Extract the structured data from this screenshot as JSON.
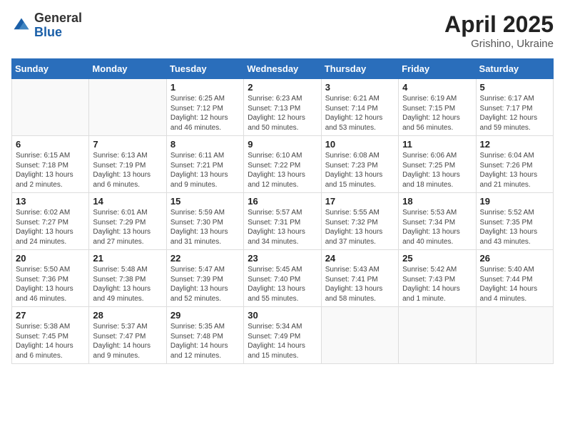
{
  "header": {
    "logo_general": "General",
    "logo_blue": "Blue",
    "month_year": "April 2025",
    "location": "Grishino, Ukraine"
  },
  "weekdays": [
    "Sunday",
    "Monday",
    "Tuesday",
    "Wednesday",
    "Thursday",
    "Friday",
    "Saturday"
  ],
  "weeks": [
    [
      {
        "day": null,
        "info": null
      },
      {
        "day": null,
        "info": null
      },
      {
        "day": "1",
        "info": "Sunrise: 6:25 AM\nSunset: 7:12 PM\nDaylight: 12 hours\nand 46 minutes."
      },
      {
        "day": "2",
        "info": "Sunrise: 6:23 AM\nSunset: 7:13 PM\nDaylight: 12 hours\nand 50 minutes."
      },
      {
        "day": "3",
        "info": "Sunrise: 6:21 AM\nSunset: 7:14 PM\nDaylight: 12 hours\nand 53 minutes."
      },
      {
        "day": "4",
        "info": "Sunrise: 6:19 AM\nSunset: 7:15 PM\nDaylight: 12 hours\nand 56 minutes."
      },
      {
        "day": "5",
        "info": "Sunrise: 6:17 AM\nSunset: 7:17 PM\nDaylight: 12 hours\nand 59 minutes."
      }
    ],
    [
      {
        "day": "6",
        "info": "Sunrise: 6:15 AM\nSunset: 7:18 PM\nDaylight: 13 hours\nand 2 minutes."
      },
      {
        "day": "7",
        "info": "Sunrise: 6:13 AM\nSunset: 7:19 PM\nDaylight: 13 hours\nand 6 minutes."
      },
      {
        "day": "8",
        "info": "Sunrise: 6:11 AM\nSunset: 7:21 PM\nDaylight: 13 hours\nand 9 minutes."
      },
      {
        "day": "9",
        "info": "Sunrise: 6:10 AM\nSunset: 7:22 PM\nDaylight: 13 hours\nand 12 minutes."
      },
      {
        "day": "10",
        "info": "Sunrise: 6:08 AM\nSunset: 7:23 PM\nDaylight: 13 hours\nand 15 minutes."
      },
      {
        "day": "11",
        "info": "Sunrise: 6:06 AM\nSunset: 7:25 PM\nDaylight: 13 hours\nand 18 minutes."
      },
      {
        "day": "12",
        "info": "Sunrise: 6:04 AM\nSunset: 7:26 PM\nDaylight: 13 hours\nand 21 minutes."
      }
    ],
    [
      {
        "day": "13",
        "info": "Sunrise: 6:02 AM\nSunset: 7:27 PM\nDaylight: 13 hours\nand 24 minutes."
      },
      {
        "day": "14",
        "info": "Sunrise: 6:01 AM\nSunset: 7:29 PM\nDaylight: 13 hours\nand 27 minutes."
      },
      {
        "day": "15",
        "info": "Sunrise: 5:59 AM\nSunset: 7:30 PM\nDaylight: 13 hours\nand 31 minutes."
      },
      {
        "day": "16",
        "info": "Sunrise: 5:57 AM\nSunset: 7:31 PM\nDaylight: 13 hours\nand 34 minutes."
      },
      {
        "day": "17",
        "info": "Sunrise: 5:55 AM\nSunset: 7:32 PM\nDaylight: 13 hours\nand 37 minutes."
      },
      {
        "day": "18",
        "info": "Sunrise: 5:53 AM\nSunset: 7:34 PM\nDaylight: 13 hours\nand 40 minutes."
      },
      {
        "day": "19",
        "info": "Sunrise: 5:52 AM\nSunset: 7:35 PM\nDaylight: 13 hours\nand 43 minutes."
      }
    ],
    [
      {
        "day": "20",
        "info": "Sunrise: 5:50 AM\nSunset: 7:36 PM\nDaylight: 13 hours\nand 46 minutes."
      },
      {
        "day": "21",
        "info": "Sunrise: 5:48 AM\nSunset: 7:38 PM\nDaylight: 13 hours\nand 49 minutes."
      },
      {
        "day": "22",
        "info": "Sunrise: 5:47 AM\nSunset: 7:39 PM\nDaylight: 13 hours\nand 52 minutes."
      },
      {
        "day": "23",
        "info": "Sunrise: 5:45 AM\nSunset: 7:40 PM\nDaylight: 13 hours\nand 55 minutes."
      },
      {
        "day": "24",
        "info": "Sunrise: 5:43 AM\nSunset: 7:41 PM\nDaylight: 13 hours\nand 58 minutes."
      },
      {
        "day": "25",
        "info": "Sunrise: 5:42 AM\nSunset: 7:43 PM\nDaylight: 14 hours\nand 1 minute."
      },
      {
        "day": "26",
        "info": "Sunrise: 5:40 AM\nSunset: 7:44 PM\nDaylight: 14 hours\nand 4 minutes."
      }
    ],
    [
      {
        "day": "27",
        "info": "Sunrise: 5:38 AM\nSunset: 7:45 PM\nDaylight: 14 hours\nand 6 minutes."
      },
      {
        "day": "28",
        "info": "Sunrise: 5:37 AM\nSunset: 7:47 PM\nDaylight: 14 hours\nand 9 minutes."
      },
      {
        "day": "29",
        "info": "Sunrise: 5:35 AM\nSunset: 7:48 PM\nDaylight: 14 hours\nand 12 minutes."
      },
      {
        "day": "30",
        "info": "Sunrise: 5:34 AM\nSunset: 7:49 PM\nDaylight: 14 hours\nand 15 minutes."
      },
      {
        "day": null,
        "info": null
      },
      {
        "day": null,
        "info": null
      },
      {
        "day": null,
        "info": null
      }
    ]
  ]
}
